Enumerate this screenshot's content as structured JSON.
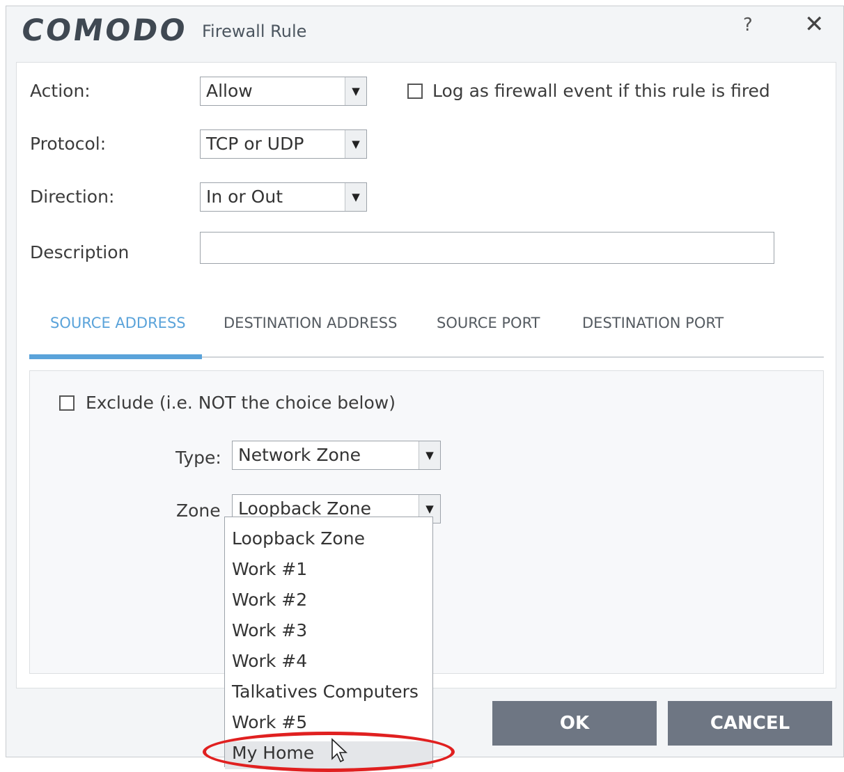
{
  "window": {
    "logo": "COMODO",
    "title": "Firewall Rule",
    "help": "?",
    "close": "✕"
  },
  "form": {
    "action": {
      "label": "Action:",
      "value": "Allow"
    },
    "log_event": {
      "label": "Log as firewall event if this rule is fired",
      "checked": false
    },
    "protocol": {
      "label": "Protocol:",
      "value": "TCP or UDP"
    },
    "direction": {
      "label": "Direction:",
      "value": "In or Out"
    },
    "description": {
      "label": "Description",
      "value": ""
    }
  },
  "tabs": [
    {
      "label": "SOURCE ADDRESS",
      "active": true
    },
    {
      "label": "DESTINATION ADDRESS",
      "active": false
    },
    {
      "label": "SOURCE PORT",
      "active": false
    },
    {
      "label": "DESTINATION PORT",
      "active": false
    }
  ],
  "source_address": {
    "exclude": {
      "label": "Exclude (i.e. NOT the choice below)",
      "checked": false
    },
    "type": {
      "label": "Type:",
      "value": "Network Zone"
    },
    "zone": {
      "label": "Zone",
      "value": "Loopback Zone"
    }
  },
  "zone_dropdown": {
    "options": [
      "Loopback Zone",
      "Work #1",
      "Work #2",
      "Work #3",
      "Work #4",
      "Talkatives Computers",
      "Work #5",
      "My Home"
    ],
    "highlighted": "My Home"
  },
  "buttons": {
    "ok": "OK",
    "cancel": "CANCEL"
  },
  "colors": {
    "accent": "#5aa3da",
    "button": "#6e7683",
    "highlight_ring": "#e02020"
  },
  "dropdown_arrow": "▼"
}
